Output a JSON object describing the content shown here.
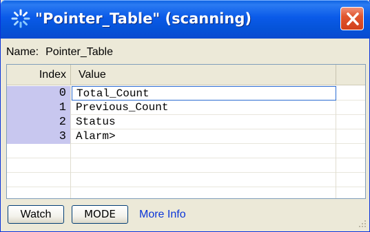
{
  "window": {
    "title": "\"Pointer_Table\" (scanning)",
    "title_icon": "scanning-spinner-icon",
    "close_icon": "close-icon"
  },
  "name_field": {
    "label": "Name:",
    "value": "Pointer_Table"
  },
  "table": {
    "columns": [
      "Index",
      "Value"
    ],
    "rows": [
      {
        "index": "0",
        "value": "Total_Count"
      },
      {
        "index": "1",
        "value": "Previous_Count"
      },
      {
        "index": "2",
        "value": "Status"
      },
      {
        "index": "3",
        "value": "Alarm>"
      }
    ],
    "selected_row": 0
  },
  "buttons": {
    "watch": "Watch",
    "mode": "MODE",
    "more_info": "More Info"
  },
  "colors": {
    "titlebar": "#0a5ae8",
    "index_fill": "#c8c7ef",
    "link": "#0a35d8",
    "close": "#d2401b"
  }
}
